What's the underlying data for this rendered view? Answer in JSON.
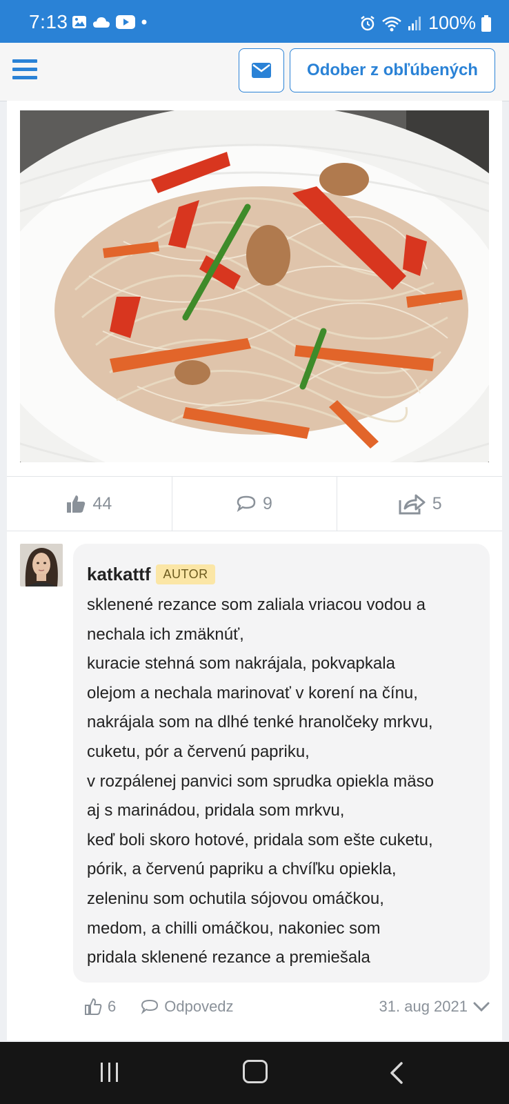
{
  "status_bar": {
    "time": "7:13",
    "battery": "100%"
  },
  "header": {
    "fav_button_label": "Odober z obľúbených"
  },
  "post": {
    "likes": "44",
    "comments": "9",
    "shares": "5"
  },
  "comment": {
    "author": "katkattf",
    "badge": "AUTOR",
    "lines": [
      "sklenené rezance som zaliala vriacou vodou a",
      "nechala ich zmäknúť,",
      "kuracie stehná som nakrájala, pokvapkala",
      "olejom a nechala marinovať v korení na čínu,",
      "nakrájala som na dlhé tenké hranolčeky mrkvu,",
      "cuketu, pór a červenú papriku,",
      "v rozpálenej panvici som sprudka opiekla mäso",
      "aj s marinádou, pridala som mrkvu,",
      "keď boli skoro hotové, pridala som ešte cuketu,",
      "pórik, a červenú papriku a chvíľku opiekla,",
      "zeleninu som ochutila sójovou omáčkou,",
      "medom, a chilli omáčkou, nakoniec som",
      "pridala sklenené rezance a premiešala"
    ],
    "likes": "6",
    "reply_label": "Odpovedz",
    "date": "31. aug 2021"
  },
  "colors": {
    "accent": "#2a82d6",
    "badge_bg": "#fbe6a6"
  }
}
